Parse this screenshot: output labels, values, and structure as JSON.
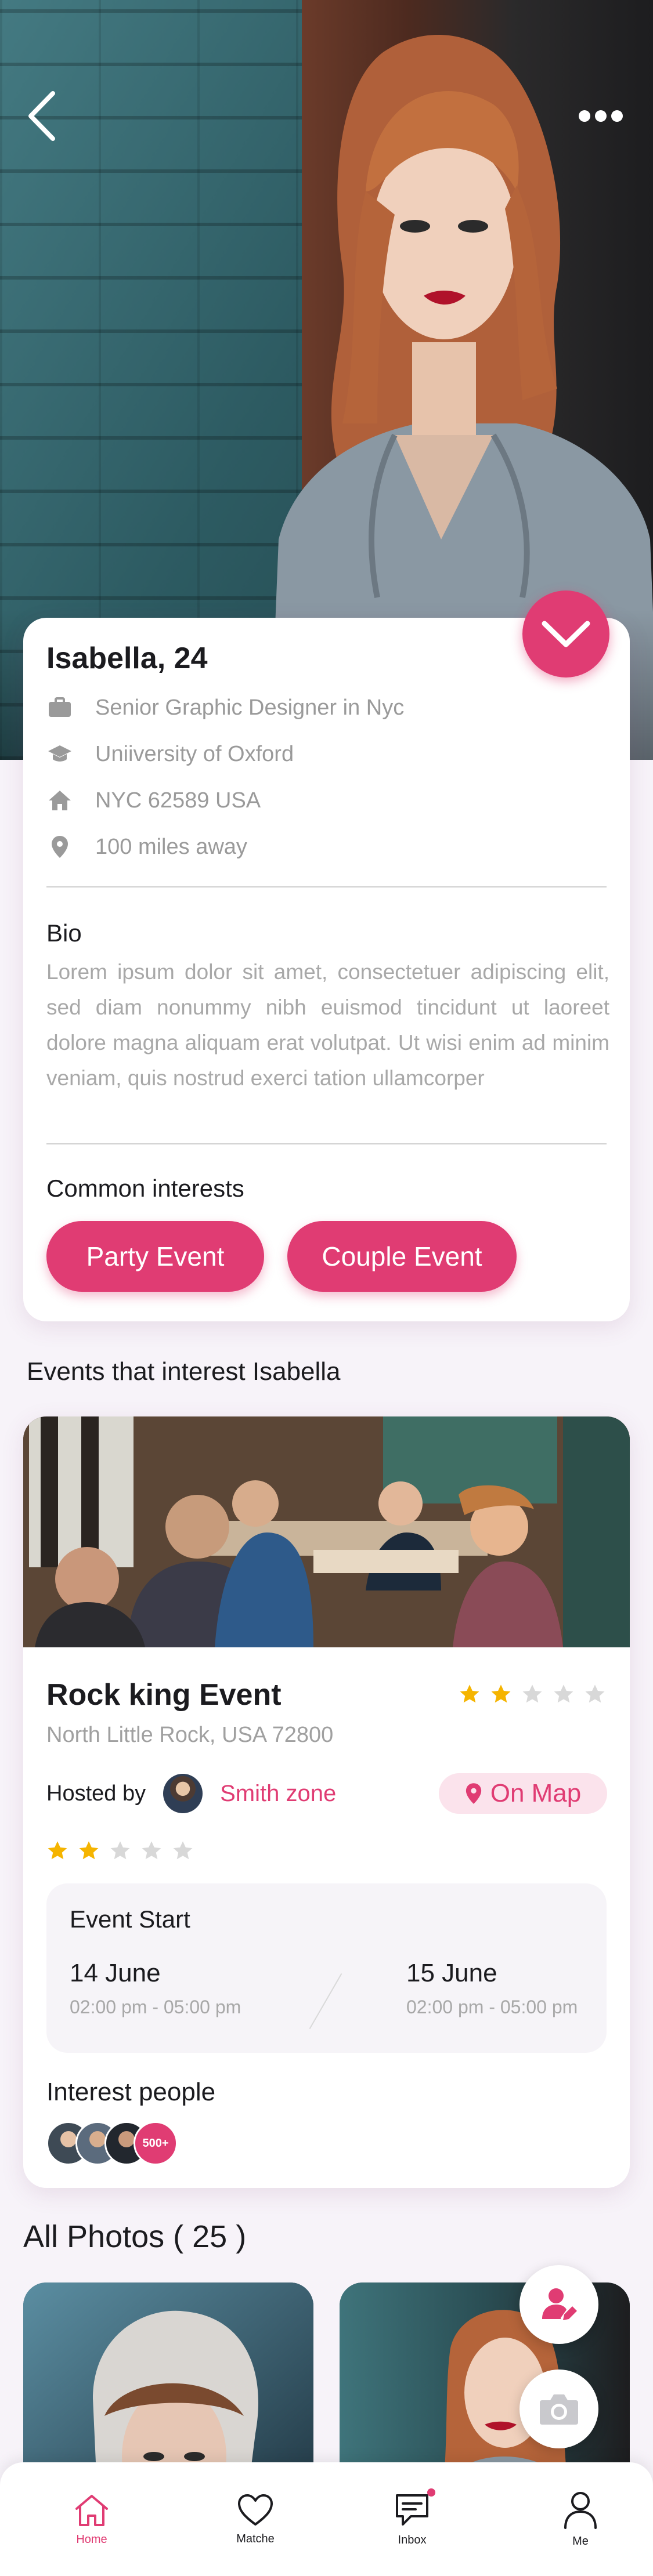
{
  "profile": {
    "name": "Isabella, 24",
    "details": [
      {
        "icon": "briefcase-icon",
        "text": "Senior Graphic Designer in Nyc"
      },
      {
        "icon": "graduation-cap-icon",
        "text": "Uniiversity of Oxford"
      },
      {
        "icon": "home-icon",
        "text": "NYC 62589 USA"
      },
      {
        "icon": "location-pin-icon",
        "text": "100 miles away"
      }
    ],
    "bio_title": "Bio",
    "bio_text": "Lorem ipsum dolor sit amet, consectetuer adipiscing elit, sed diam nonummy nibh euismod tincidunt ut laoreet dolore magna aliquam erat volutpat. Ut wisi enim ad minim veniam, quis nostrud exerci tation ullamcorper",
    "interests_title": "Common interests",
    "interests": [
      "Party Event",
      "Couple Event"
    ]
  },
  "events_heading": "Events that interest Isabella",
  "event": {
    "title": "Rock king Event",
    "address": "North Little Rock, USA 72800",
    "rating": 2,
    "rating_max": 5,
    "hosted_by_label": "Hosted by",
    "host_name": "Smith zone",
    "host_rating": 2,
    "map_label": "On Map",
    "start_label": "Event Start",
    "start_date": "14 June",
    "start_time": "02:00 pm - 05:00 pm",
    "end_date": "15 June",
    "end_time": "02:00 pm - 05:00 pm",
    "interest_title": "Interest people",
    "interest_count": "500+"
  },
  "photos": {
    "heading": "All Photos ( 25 )"
  },
  "tabs": [
    {
      "label": "Home",
      "icon": "home-icon",
      "active": true
    },
    {
      "label": "Matche",
      "icon": "heart-icon",
      "active": false
    },
    {
      "label": "Inbox",
      "icon": "chat-icon",
      "active": false,
      "badge": true
    },
    {
      "label": "Me",
      "icon": "user-icon",
      "active": false
    }
  ],
  "colors": {
    "accent": "#e03c73",
    "star": "#f5b400",
    "star_empty": "#d8d8d8",
    "muted_text": "#a0a0a0"
  }
}
